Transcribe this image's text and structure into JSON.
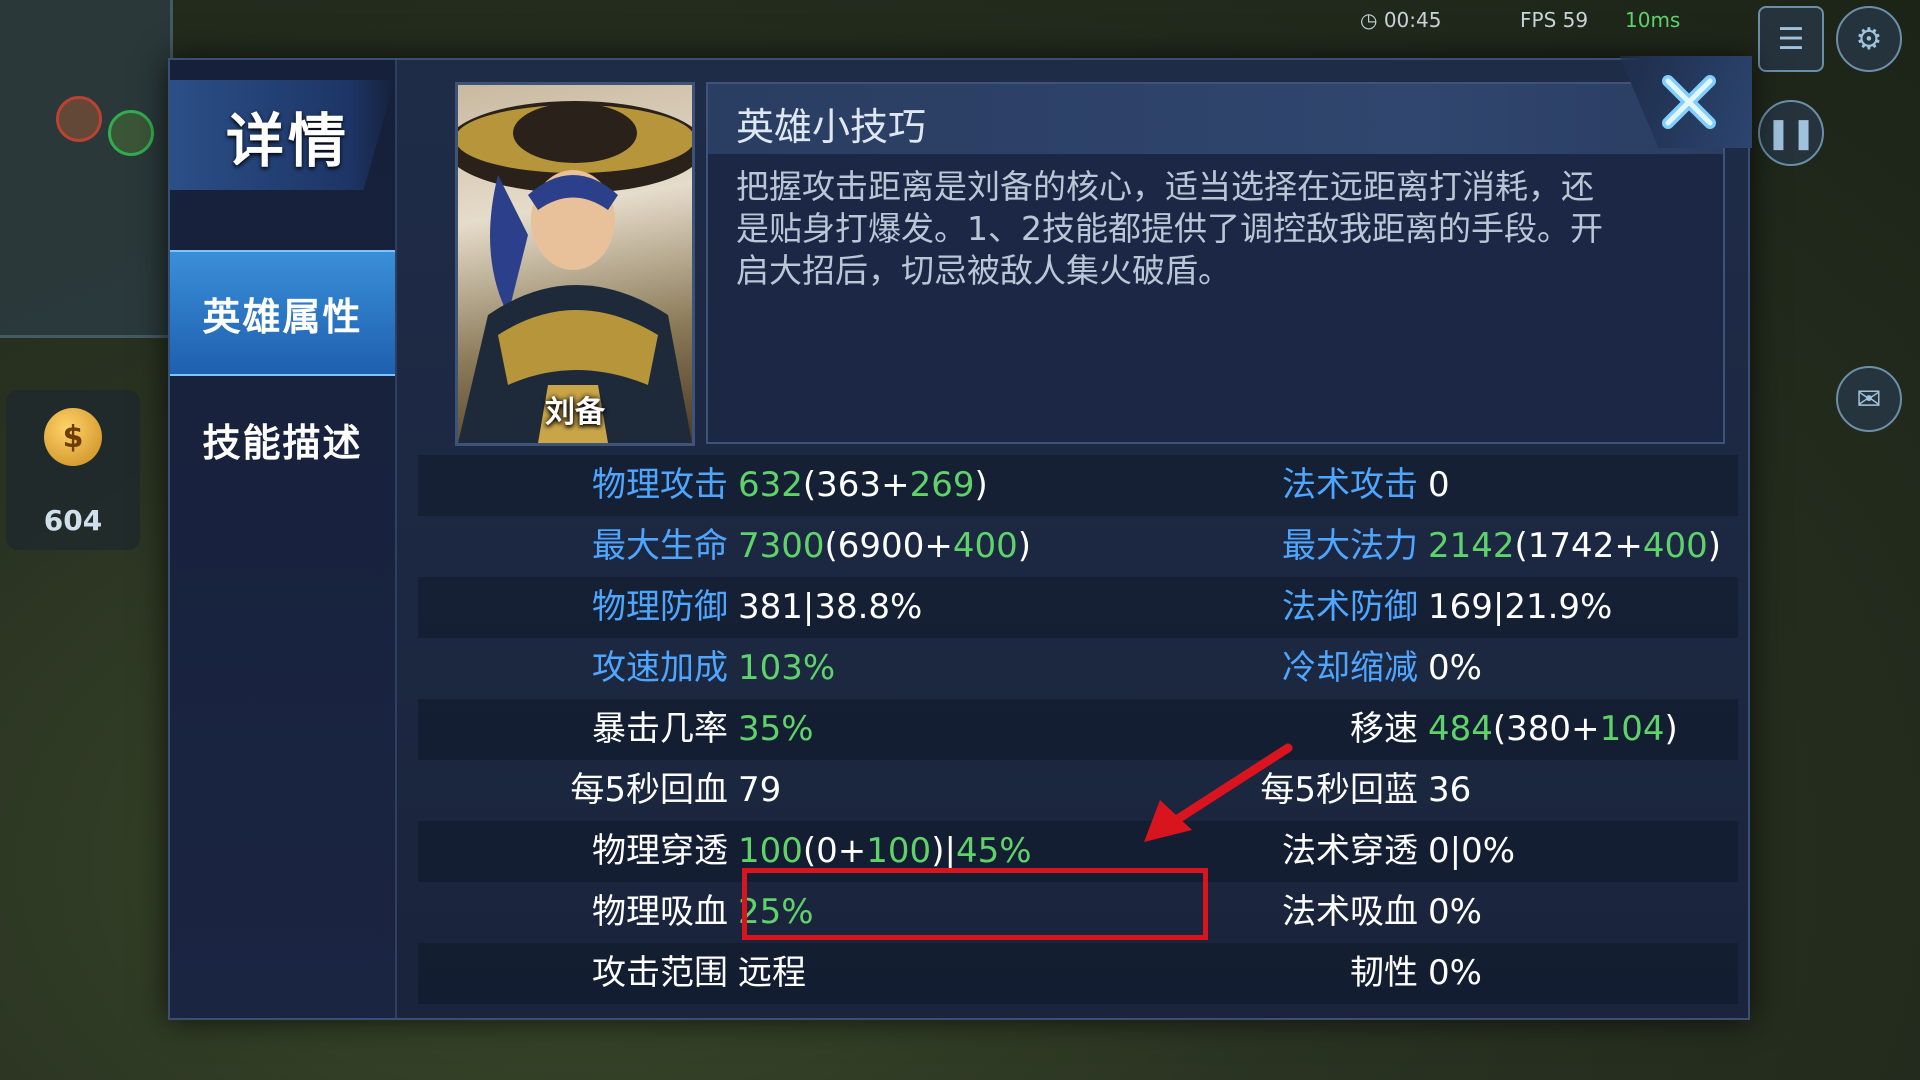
{
  "hud": {
    "time": "00:45",
    "fps": "FPS 59",
    "ping": "10ms",
    "gold": "604",
    "gold_symbol": "$"
  },
  "panel": {
    "title": "详情",
    "tabs": [
      {
        "label": "英雄属性",
        "active": true
      },
      {
        "label": "技能描述",
        "active": false
      }
    ],
    "hero_name": "刘备",
    "tips_title": "英雄小技巧",
    "tips_text": "把握攻击距离是刘备的核心，适当选择在远距离打消耗，还是贴身打爆发。1、2技能都提供了调控敌我距离的手段。开启大招后，切忌被敌人集火破盾。"
  },
  "stats": [
    {
      "left": {
        "label": "物理攻击",
        "label_color": "blue",
        "parts": [
          {
            "t": "632",
            "c": "g"
          },
          {
            "t": "(363+",
            "c": "w"
          },
          {
            "t": "269",
            "c": "g"
          },
          {
            "t": ")",
            "c": "w"
          }
        ]
      },
      "right": {
        "label": "法术攻击",
        "label_color": "blue",
        "parts": [
          {
            "t": "0",
            "c": "w"
          }
        ]
      }
    },
    {
      "left": {
        "label": "最大生命",
        "label_color": "blue",
        "parts": [
          {
            "t": "7300",
            "c": "g"
          },
          {
            "t": "(6900+",
            "c": "w"
          },
          {
            "t": "400",
            "c": "g"
          },
          {
            "t": ")",
            "c": "w"
          }
        ]
      },
      "right": {
        "label": "最大法力",
        "label_color": "blue",
        "parts": [
          {
            "t": "2142",
            "c": "g"
          },
          {
            "t": "(1742+",
            "c": "w"
          },
          {
            "t": "400",
            "c": "g"
          },
          {
            "t": ")",
            "c": "w"
          }
        ]
      }
    },
    {
      "left": {
        "label": "物理防御",
        "label_color": "blue",
        "parts": [
          {
            "t": "381|38.8%",
            "c": "w"
          }
        ]
      },
      "right": {
        "label": "法术防御",
        "label_color": "blue",
        "parts": [
          {
            "t": "169|21.9%",
            "c": "w"
          }
        ]
      }
    },
    {
      "left": {
        "label": "攻速加成",
        "label_color": "blue",
        "parts": [
          {
            "t": "103%",
            "c": "g"
          }
        ]
      },
      "right": {
        "label": "冷却缩减",
        "label_color": "blue",
        "parts": [
          {
            "t": "0%",
            "c": "w"
          }
        ]
      }
    },
    {
      "left": {
        "label": "暴击几率",
        "label_color": "white",
        "parts": [
          {
            "t": "35%",
            "c": "g"
          }
        ]
      },
      "right": {
        "label": "移速",
        "label_color": "white",
        "parts": [
          {
            "t": "484",
            "c": "g"
          },
          {
            "t": "(380+",
            "c": "w"
          },
          {
            "t": "104",
            "c": "g"
          },
          {
            "t": ")",
            "c": "w"
          }
        ]
      }
    },
    {
      "left": {
        "label": "每5秒回血",
        "label_color": "white",
        "parts": [
          {
            "t": "79",
            "c": "w"
          }
        ]
      },
      "right": {
        "label": "每5秒回蓝",
        "label_color": "white",
        "parts": [
          {
            "t": "36",
            "c": "w"
          }
        ]
      }
    },
    {
      "left": {
        "label": "物理穿透",
        "label_color": "white",
        "parts": [
          {
            "t": "100",
            "c": "g"
          },
          {
            "t": "(0+",
            "c": "w"
          },
          {
            "t": "100",
            "c": "g"
          },
          {
            "t": ")|",
            "c": "w"
          },
          {
            "t": "45%",
            "c": "g"
          }
        ]
      },
      "right": {
        "label": "法术穿透",
        "label_color": "white",
        "parts": [
          {
            "t": "0|0%",
            "c": "w"
          }
        ]
      }
    },
    {
      "left": {
        "label": "物理吸血",
        "label_color": "white",
        "parts": [
          {
            "t": "25%",
            "c": "g"
          }
        ]
      },
      "right": {
        "label": "法术吸血",
        "label_color": "white",
        "parts": [
          {
            "t": "0%",
            "c": "w"
          }
        ]
      }
    },
    {
      "left": {
        "label": "攻击范围",
        "label_color": "white",
        "parts": [
          {
            "t": "远程",
            "c": "w"
          }
        ]
      },
      "right": {
        "label": "韧性",
        "label_color": "white",
        "parts": [
          {
            "t": "0%",
            "c": "w"
          }
        ]
      }
    }
  ],
  "annotation": {
    "highlight_color": "#d8141e",
    "arrow_color": "#d8141e"
  },
  "icons": {
    "close": "close-icon",
    "gold": "gold-bag-icon",
    "settings": "gear-icon",
    "pause": "pause-icon",
    "menu": "menu-icon",
    "chat": "chat-icon"
  }
}
